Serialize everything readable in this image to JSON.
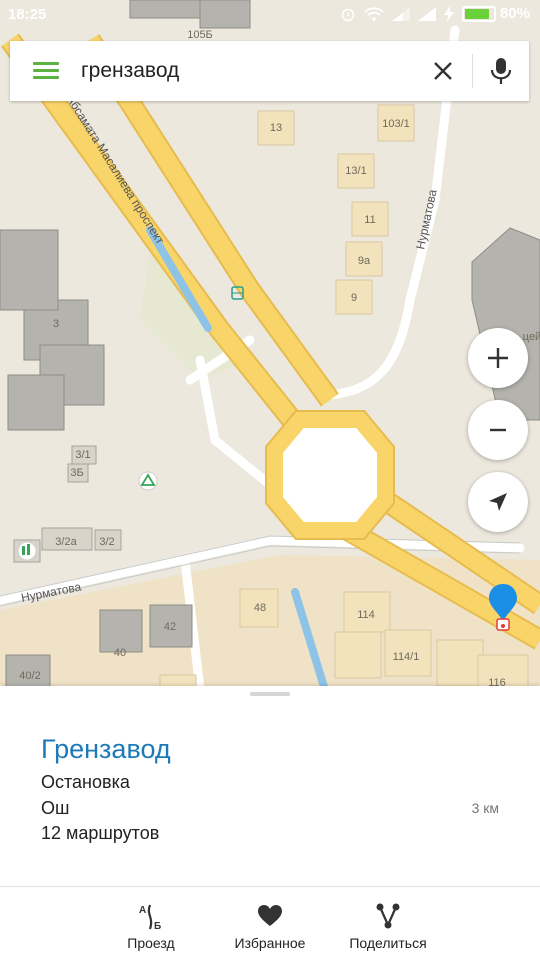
{
  "status": {
    "time": "18:25",
    "battery": "80%",
    "battery_level": 0.8
  },
  "search": {
    "value": "грензавод",
    "placeholder": ""
  },
  "map": {
    "street_labels": {
      "prospect": "Абсамата Масалиева проспект",
      "nurmatova_east": "Нурматова",
      "nurmatova_south": "Нурматова"
    },
    "buildings": {
      "b105b": "105Б",
      "b13": "13",
      "b103_1": "103/1",
      "b13_1": "13/1",
      "b11": "11",
      "b9a": "9а",
      "b9": "9",
      "b3": "3",
      "b3_1": "3/1",
      "b3b": "3Б",
      "b3_2a": "3/2а",
      "b3_2": "3/2",
      "b48": "48",
      "b114": "114",
      "b114_1": "114/1",
      "b116": "116",
      "b42": "42",
      "b40": "40",
      "b40_2": "40/2",
      "b_cut": "цей"
    }
  },
  "place": {
    "title": "Грензавод",
    "type": "Остановка",
    "city": "Ош",
    "distance": "3 км",
    "routes": "12 маршрутов"
  },
  "actions": {
    "route": "Проезд",
    "favorites": "Избранное",
    "share": "Поделиться"
  },
  "colors": {
    "accent_green": "#5db141",
    "title_blue": "#1d7ab8",
    "road_yellow": "#f8d469",
    "pin_blue": "#1b8fe6",
    "stop_red": "#e53935"
  }
}
